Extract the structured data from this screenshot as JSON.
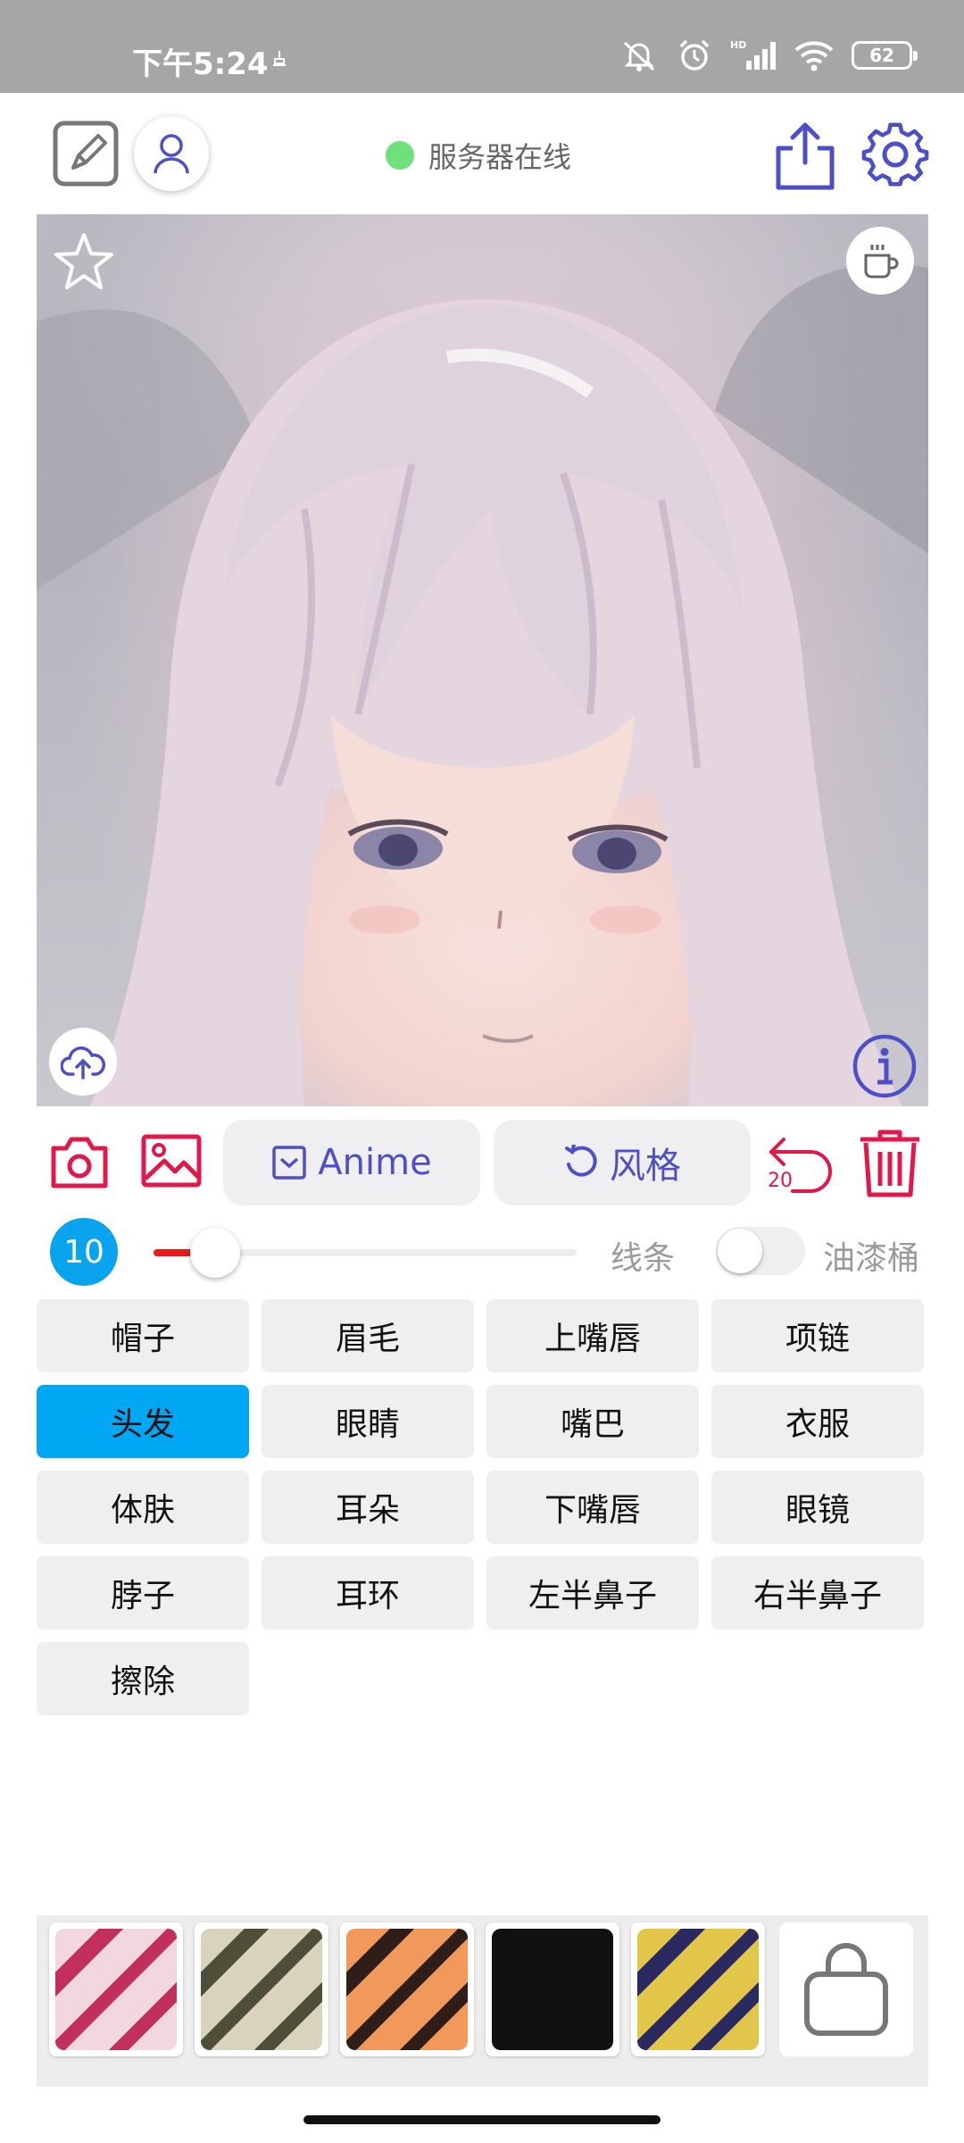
{
  "status_bar": {
    "time": "下午5:24",
    "battery": "62"
  },
  "top_bar": {
    "server_status": "服务器在线"
  },
  "tools": {
    "anime_label": "Anime",
    "style_label": "风格",
    "undo_count": "20"
  },
  "brush": {
    "size": "10",
    "slider_value": 0.12,
    "line_label": "线条",
    "bucket_label": "油漆桶",
    "bucket_enabled": false
  },
  "parts": [
    {
      "label": "帽子",
      "active": false
    },
    {
      "label": "眉毛",
      "active": false
    },
    {
      "label": "上嘴唇",
      "active": false
    },
    {
      "label": "项链",
      "active": false
    },
    {
      "label": "头发",
      "active": true
    },
    {
      "label": "眼睛",
      "active": false
    },
    {
      "label": "嘴巴",
      "active": false
    },
    {
      "label": "衣服",
      "active": false
    },
    {
      "label": "体肤",
      "active": false
    },
    {
      "label": "耳朵",
      "active": false
    },
    {
      "label": "下嘴唇",
      "active": false
    },
    {
      "label": "眼镜",
      "active": false
    },
    {
      "label": "脖子",
      "active": false
    },
    {
      "label": "耳环",
      "active": false
    },
    {
      "label": "左半鼻子",
      "active": false
    },
    {
      "label": "右半鼻子",
      "active": false
    },
    {
      "label": "擦除",
      "active": false
    }
  ],
  "palette": [
    {
      "name": "red-pattern",
      "base": "#f3d7df",
      "stripe": "#c0305a"
    },
    {
      "name": "olive-pattern",
      "base": "#d9d2bd",
      "stripe": "#4f4e38"
    },
    {
      "name": "orange-pattern",
      "base": "#f0995a",
      "stripe": "#2f1d1a"
    },
    {
      "name": "black-pattern",
      "base": "#121013",
      "stripe": "#1f1a1f"
    },
    {
      "name": "yellow-pattern",
      "base": "#e2c64a",
      "stripe": "#2a2a60"
    }
  ],
  "colors": {
    "accent": "#4d4fc8",
    "danger": "#e0194a",
    "active": "#00a8f3",
    "online": "#6fe07a"
  },
  "icons": [
    "edit-icon",
    "user-icon",
    "share-icon",
    "gear-icon",
    "star-icon",
    "coffee-icon",
    "cloud-upload-icon",
    "info-icon",
    "camera-icon",
    "image-icon",
    "anime-icon",
    "refresh-icon",
    "undo-icon",
    "trash-icon",
    "shopping-bag-icon"
  ]
}
